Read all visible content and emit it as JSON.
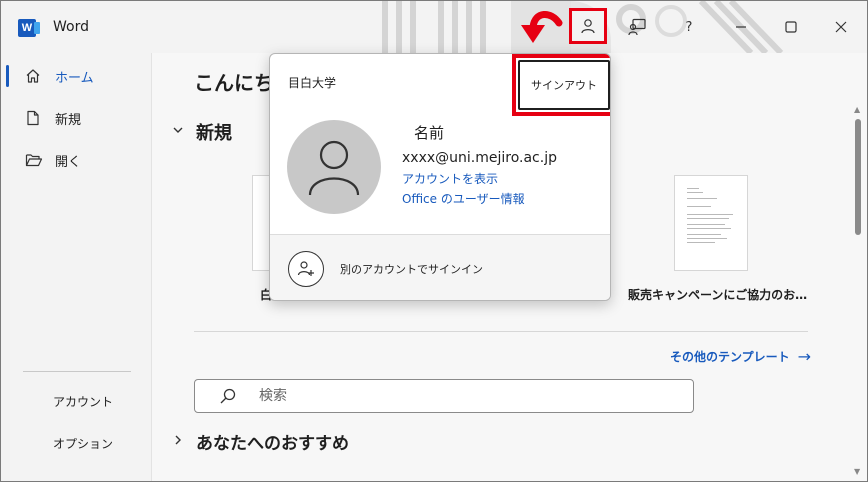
{
  "app": {
    "title": "Word",
    "logo_letter": "W"
  },
  "titlebar": {
    "help_label": "?",
    "minimize_label": "—",
    "maximize_label": "▢",
    "close_label": "✕"
  },
  "sidebar": {
    "items": [
      {
        "label": "ホーム",
        "icon": "home-icon",
        "active": true
      },
      {
        "label": "新規",
        "icon": "new-document-icon"
      },
      {
        "label": "開く",
        "icon": "folder-open-icon"
      }
    ],
    "bottom": [
      {
        "label": "アカウント"
      },
      {
        "label": "オプション"
      }
    ]
  },
  "main": {
    "greeting": "こんにち",
    "section_new": "新規",
    "templates": [
      {
        "label": "白"
      },
      {
        "label": "販売キャンペーンにご協力のお…"
      }
    ],
    "more_templates": "その他のテンプレート",
    "search_placeholder": "検索",
    "section_recommended": "あなたへのおすすめ"
  },
  "popup": {
    "organization": "目白大学",
    "signout_label": "サインアウト",
    "user_name": "名前",
    "user_email": "xxxx@uni.mejiro.ac.jp",
    "view_account": "アカウントを表示",
    "office_user_info": "Office のユーザー情報",
    "other_account": "別のアカウントでサインイン"
  },
  "colors": {
    "accent": "#185abd",
    "highlight": "#e60012",
    "avatar_bg": "#c8c8c8"
  }
}
